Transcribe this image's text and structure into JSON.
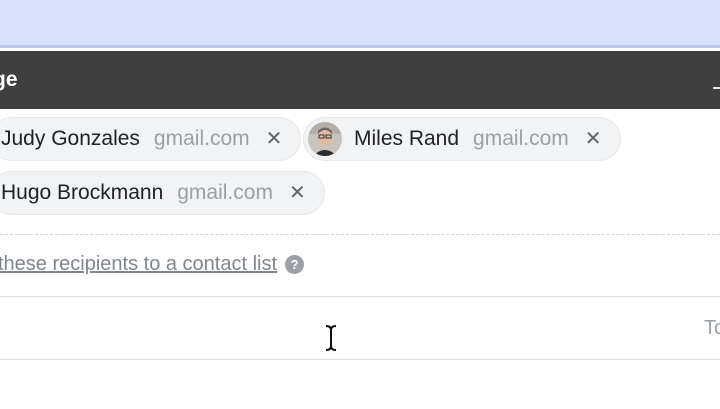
{
  "compose": {
    "title": "ge",
    "recipients": [
      {
        "name": "Judy Gonzales",
        "domain": "gmail.com",
        "remove_icon": "close-icon"
      },
      {
        "name": "Miles Rand",
        "domain": "gmail.com",
        "remove_icon": "close-icon",
        "has_avatar": true
      },
      {
        "name": "Hugo Brockmann",
        "domain": "gmail.com",
        "remove_icon": "close-icon"
      }
    ],
    "remove_glyph": "✕",
    "add_contacts_link": "these recipients to a contact list",
    "help_glyph": "?",
    "subject_side_label": "To"
  },
  "colors": {
    "titlebar": "#404040",
    "top_strip": "#d6e2fb",
    "chip_bg": "#f1f3f4",
    "link": "#80868b"
  }
}
